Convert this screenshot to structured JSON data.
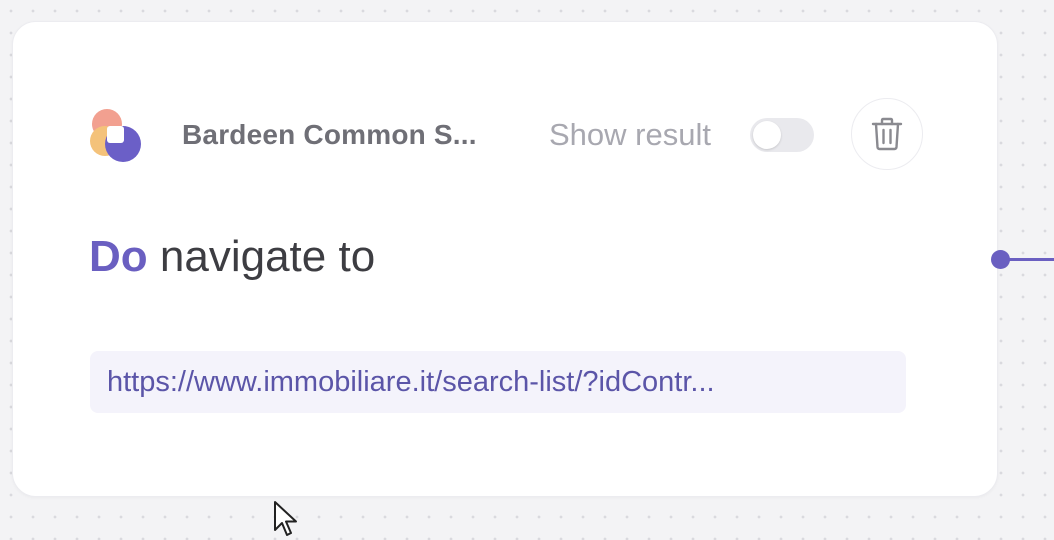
{
  "node": {
    "app_name": "Bardeen Common S...",
    "app_icon": "bardeen-common-logo",
    "show_result_label": "Show result",
    "show_result_enabled": false,
    "delete_icon": "trash-icon",
    "action_keyword": "Do",
    "action_text": "navigate to",
    "url_value": "https://www.immobiliare.it/search-list/?idContr..."
  },
  "colors": {
    "accent": "#6a5fc1",
    "url_chip_bg": "#f4f3fb",
    "url_text": "#5b55a8",
    "muted_text": "#a8a8b0",
    "app_name_text": "#6f6f76"
  },
  "canvas": {
    "connector_icon": "output-connector-dot"
  }
}
